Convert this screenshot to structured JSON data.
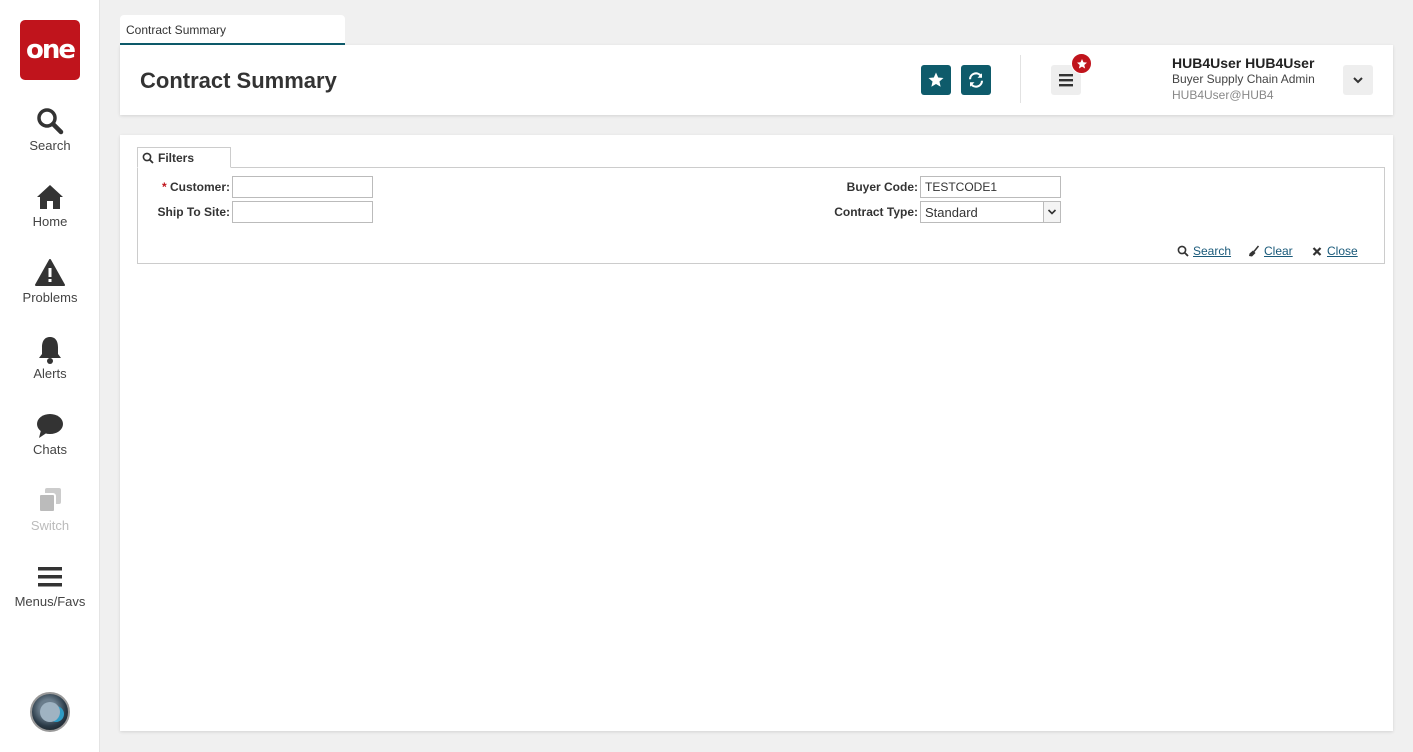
{
  "sidebar": {
    "logo_text": "one",
    "items": [
      {
        "label": "Search",
        "icon": "search-icon"
      },
      {
        "label": "Home",
        "icon": "home-icon"
      },
      {
        "label": "Problems",
        "icon": "warning-icon"
      },
      {
        "label": "Alerts",
        "icon": "bell-icon"
      },
      {
        "label": "Chats",
        "icon": "chat-icon"
      },
      {
        "label": "Switch",
        "icon": "switch-icon",
        "disabled": true
      },
      {
        "label": "Menus/Favs",
        "icon": "hamburger-icon"
      }
    ]
  },
  "tab": {
    "label": "Contract Summary"
  },
  "header": {
    "title": "Contract Summary",
    "user": {
      "name": "HUB4User HUB4User",
      "role": "Buyer Supply Chain Admin",
      "email": "HUB4User@HUB4"
    }
  },
  "filters": {
    "tab_label": "Filters",
    "required_mark": "*",
    "customer": {
      "label": "Customer:",
      "value": ""
    },
    "ship_to_site": {
      "label": "Ship To Site:",
      "value": ""
    },
    "buyer_code": {
      "label": "Buyer Code:",
      "value": "TESTCODE1"
    },
    "contract_type": {
      "label": "Contract Type:",
      "value": "Standard"
    },
    "actions": {
      "search": "Search",
      "clear": "Clear",
      "close": "Close"
    }
  },
  "colors": {
    "brand_red": "#c0141c",
    "accent_teal": "#0e5b6b",
    "link": "#1a5a7a"
  }
}
